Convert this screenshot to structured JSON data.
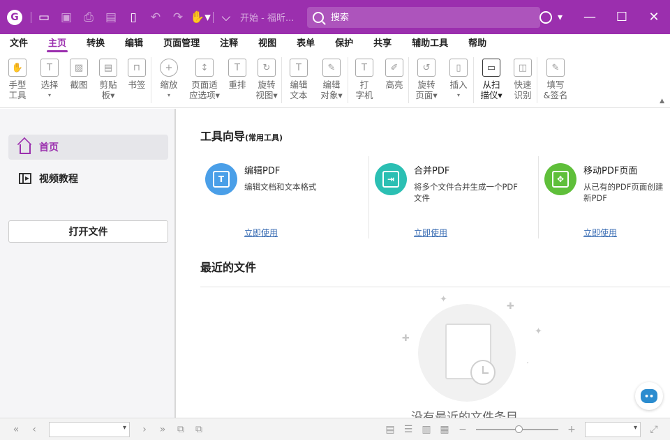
{
  "titlebar": {
    "doc_title": "开始 - 福昕...",
    "search_placeholder": "搜索"
  },
  "menu": {
    "items": [
      "文件",
      "主页",
      "转换",
      "编辑",
      "页面管理",
      "注释",
      "视图",
      "表单",
      "保护",
      "共享",
      "辅助工具",
      "帮助"
    ],
    "active": "主页"
  },
  "ribbon": {
    "buttons": [
      {
        "l1": "手型",
        "l2": "工具",
        "icon": "hand-icon"
      },
      {
        "l1": "选择",
        "l2": "▾",
        "icon": "select-icon"
      },
      {
        "l1": "截图",
        "l2": "",
        "icon": "snapshot-icon"
      },
      {
        "l1": "剪贴",
        "l2": "板▾",
        "icon": "clipboard-icon"
      },
      {
        "l1": "书签",
        "l2": "",
        "icon": "bookmark-icon"
      },
      {
        "l1": "缩放",
        "l2": "▾",
        "icon": "zoom-icon"
      },
      {
        "l1": "页面适",
        "l2": "应选项▾",
        "icon": "fit-page-icon"
      },
      {
        "l1": "重排",
        "l2": "",
        "icon": "reflow-icon"
      },
      {
        "l1": "旋转",
        "l2": "视图▾",
        "icon": "rotate-view-icon"
      },
      {
        "l1": "编辑",
        "l2": "文本",
        "icon": "edit-text-icon"
      },
      {
        "l1": "编辑",
        "l2": "对象▾",
        "icon": "edit-object-icon"
      },
      {
        "l1": "打",
        "l2": "字机",
        "icon": "typewriter-icon"
      },
      {
        "l1": "高亮",
        "l2": "",
        "icon": "highlight-icon"
      },
      {
        "l1": "旋转",
        "l2": "页面▾",
        "icon": "rotate-page-icon"
      },
      {
        "l1": "插入",
        "l2": "▾",
        "icon": "insert-icon"
      },
      {
        "l1": "从扫",
        "l2": "描仪▾",
        "icon": "scanner-icon"
      },
      {
        "l1": "快速",
        "l2": "识别",
        "icon": "ocr-icon"
      },
      {
        "l1": "填写",
        "l2": "&签名",
        "icon": "fill-sign-icon"
      }
    ]
  },
  "sidebar": {
    "home": "首页",
    "video": "视频教程",
    "open_file": "打开文件"
  },
  "main": {
    "tool_guide_title": "工具向导",
    "tool_guide_sub": "(常用工具)",
    "tools": [
      {
        "name": "编辑PDF",
        "desc": "编辑文档和文本格式",
        "link": "立即使用",
        "color": "#4a9fe8"
      },
      {
        "name": "合并PDF",
        "desc": "将多个文件合并生成一个PDF文件",
        "link": "立即使用",
        "color": "#2bbfb3"
      },
      {
        "name": "移动PDF页面",
        "desc": "从已有的PDF页面创建新PDF",
        "link": "立即使用",
        "color": "#5fbf3a"
      }
    ],
    "recent_title": "最近的文件",
    "empty_text": "没有最近的文件条目"
  },
  "colors": {
    "brand": "#9b2fae"
  }
}
